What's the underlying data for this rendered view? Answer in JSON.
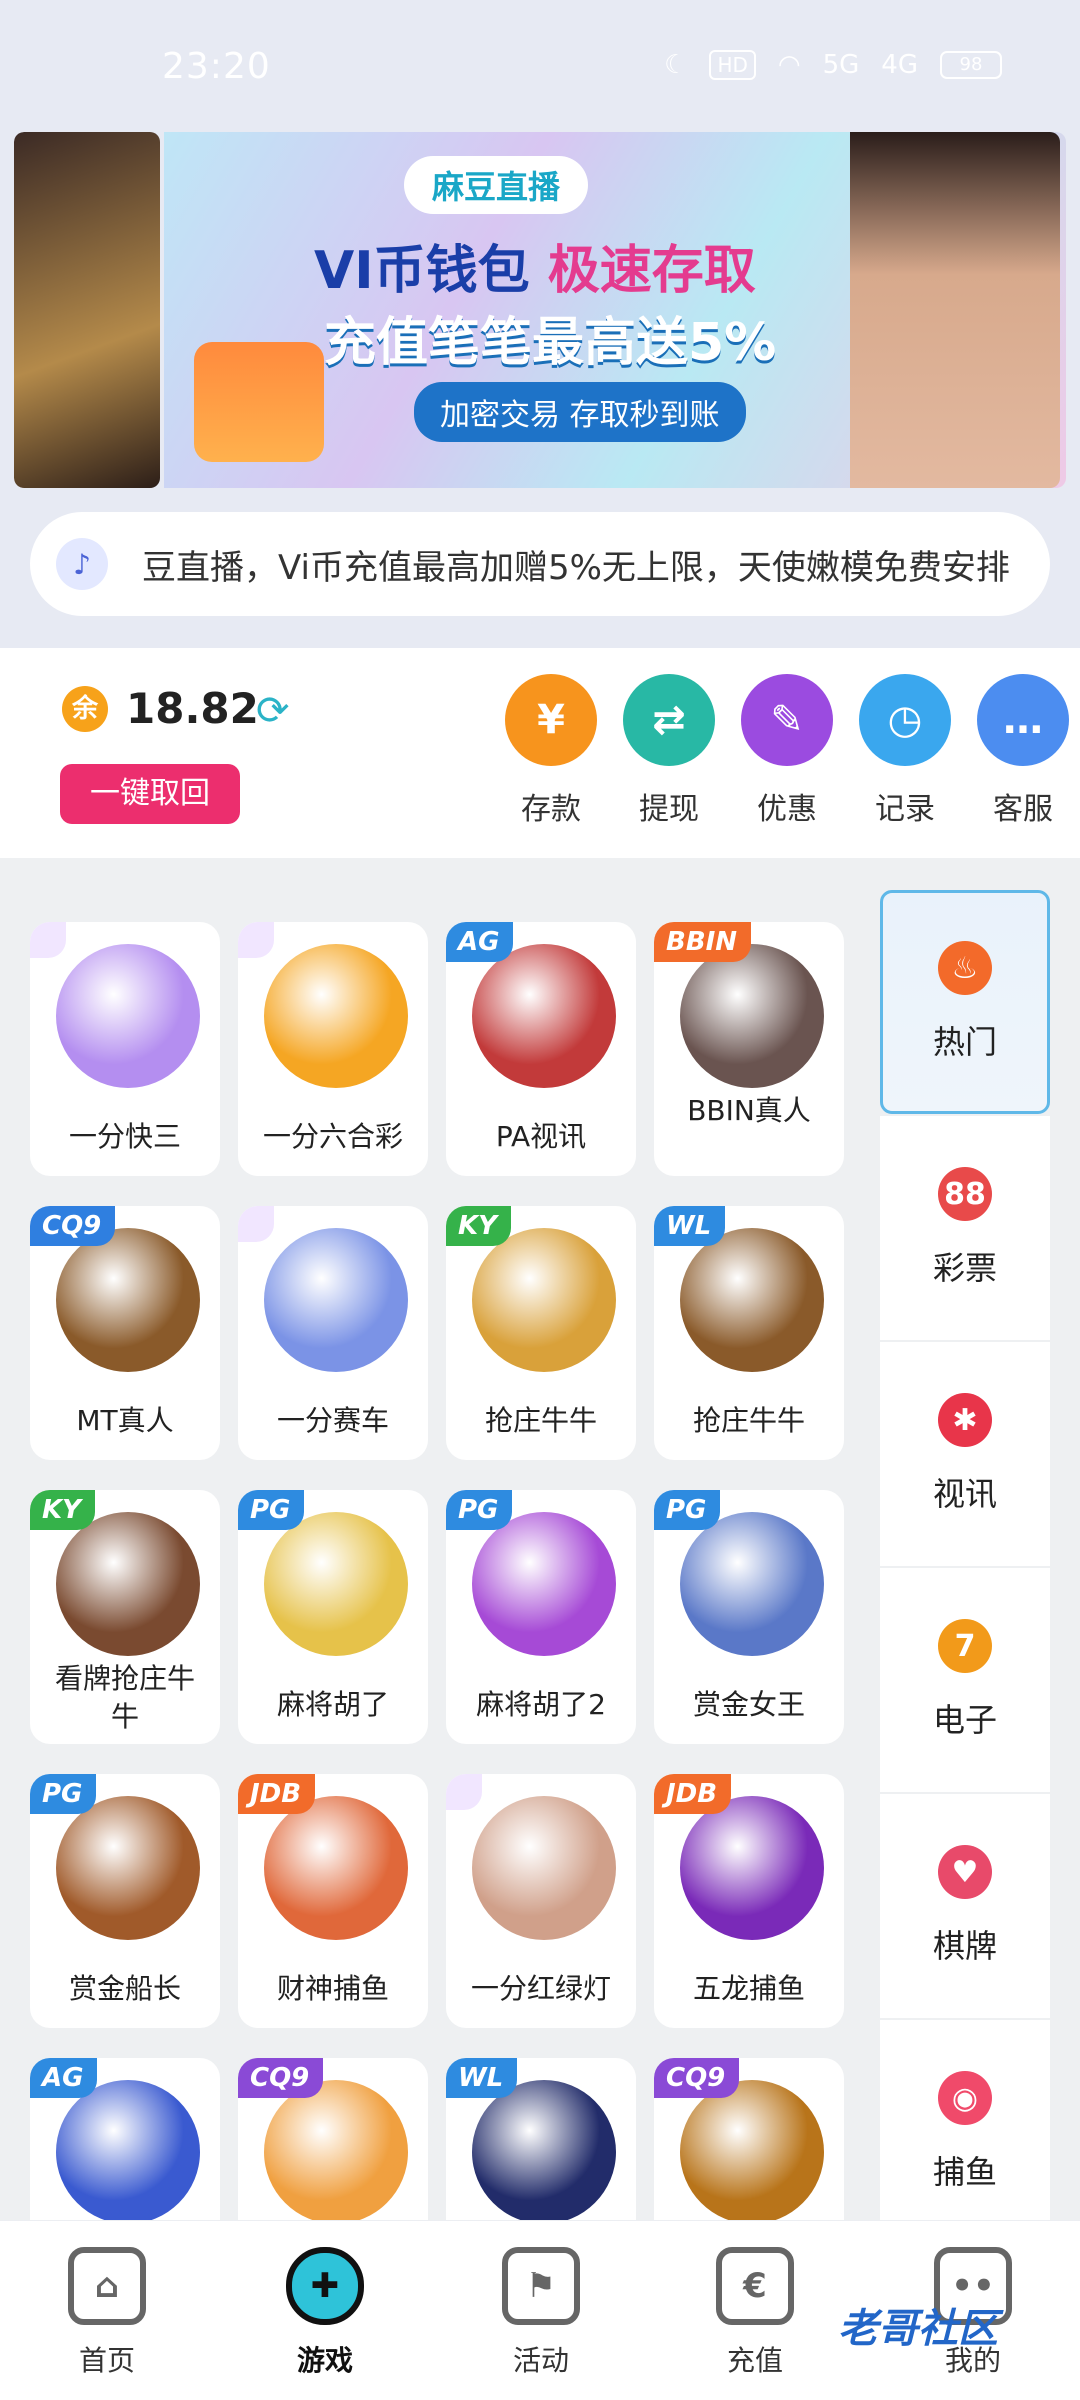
{
  "status_bar": {
    "time": "23:20",
    "hd": "HD",
    "net1": "5G",
    "net2": "4G",
    "battery": "98"
  },
  "banner": {
    "brand": "麻豆直播",
    "line1a": "VI币钱包",
    "line1b": "极速存取",
    "line2": "充值笔笔最高送5%",
    "line3": "加密交易 存取秒到账"
  },
  "marquee": {
    "text": "豆直播，Vi币充值最高加赠5%无上限，天使嫩模免费安排"
  },
  "wallet": {
    "balance_icon": "余",
    "balance": "18.82",
    "withdraw_all": "一键取回",
    "actions": [
      {
        "label": "存款",
        "icon": "yen-icon",
        "color": "#f7941d",
        "glyph": "¥"
      },
      {
        "label": "提现",
        "icon": "exchange-icon",
        "color": "#28b8a5",
        "glyph": "⇄"
      },
      {
        "label": "优惠",
        "icon": "tag-icon",
        "color": "#9b4be0",
        "glyph": "✎"
      },
      {
        "label": "记录",
        "icon": "clock-icon",
        "color": "#3aa7ee",
        "glyph": "◷"
      },
      {
        "label": "客服",
        "icon": "chat-icon",
        "color": "#4c8df0",
        "glyph": "…"
      }
    ]
  },
  "games": [
    {
      "name": "一分快三",
      "tag": "",
      "tag_color": "",
      "art": "#b48ef0"
    },
    {
      "name": "一分六合彩",
      "tag": "",
      "tag_color": "",
      "art": "#f5a623"
    },
    {
      "name": "PA视讯",
      "tag": "AG",
      "tag_color": "#2e8be0",
      "art": "#c23a3a"
    },
    {
      "name": "BBIN真人",
      "tag": "BBIN",
      "tag_color": "#f26b2a",
      "art": "#6a5450"
    },
    {
      "name": "MT真人",
      "tag": "CQ9",
      "tag_color": "#2f7fe0",
      "art": "#8a5a2a"
    },
    {
      "name": "一分赛车",
      "tag": "",
      "tag_color": "",
      "art": "#7b93e6"
    },
    {
      "name": "抢庄牛牛",
      "tag": "KY",
      "tag_color": "#35b24a",
      "art": "#d9a13a"
    },
    {
      "name": "抢庄牛牛",
      "tag": "WL",
      "tag_color": "#2e8be0",
      "art": "#8a5a2a"
    },
    {
      "name": "看牌抢庄牛牛",
      "tag": "KY",
      "tag_color": "#35b24a",
      "art": "#7a4a30"
    },
    {
      "name": "麻将胡了",
      "tag": "PG",
      "tag_color": "#2e8be0",
      "art": "#e6c24a"
    },
    {
      "name": "麻将胡了2",
      "tag": "PG",
      "tag_color": "#2e8be0",
      "art": "#a64ad6"
    },
    {
      "name": "赏金女王",
      "tag": "PG",
      "tag_color": "#2e8be0",
      "art": "#5a78c8"
    },
    {
      "name": "赏金船长",
      "tag": "PG",
      "tag_color": "#2e8be0",
      "art": "#a05a2a"
    },
    {
      "name": "财神捕鱼",
      "tag": "JDB",
      "tag_color": "#f26b2a",
      "art": "#e0683a"
    },
    {
      "name": "一分红绿灯",
      "tag": "",
      "tag_color": "",
      "art": "#d0a08a"
    },
    {
      "name": "五龙捕鱼",
      "tag": "JDB",
      "tag_color": "#f26b2a",
      "art": "#7a2ab8"
    },
    {
      "name": "",
      "tag": "AG",
      "tag_color": "#2e8be0",
      "art": "#3a5ad0"
    },
    {
      "name": "",
      "tag": "CQ9",
      "tag_color": "#8a4ad6",
      "art": "#f0a040"
    },
    {
      "name": "",
      "tag": "WL",
      "tag_color": "#2e8be0",
      "art": "#222c6a"
    },
    {
      "name": "",
      "tag": "CQ9",
      "tag_color": "#8a4ad6",
      "art": "#b8741a"
    }
  ],
  "categories": [
    {
      "label": "热门",
      "icon": "fire-icon",
      "color": "#f36a2a",
      "glyph": "♨",
      "active": true
    },
    {
      "label": "彩票",
      "icon": "lottery-ball-icon",
      "color": "#e84a4a",
      "glyph": "88",
      "active": false
    },
    {
      "label": "视讯",
      "icon": "chip-icon",
      "color": "#e8354a",
      "glyph": "✱",
      "active": false
    },
    {
      "label": "电子",
      "icon": "slot-seven-icon",
      "color": "#f29a1a",
      "glyph": "7",
      "active": false
    },
    {
      "label": "棋牌",
      "icon": "cards-icon",
      "color": "#e84a6a",
      "glyph": "♥",
      "active": false
    },
    {
      "label": "捕鱼",
      "icon": "fish-icon",
      "color": "#f04a6a",
      "glyph": "◉",
      "active": false
    }
  ],
  "tabbar": [
    {
      "label": "首页",
      "icon": "home-icon",
      "glyph": "⌂",
      "active": false
    },
    {
      "label": "游戏",
      "icon": "gamepad-icon",
      "glyph": "✚",
      "active": true
    },
    {
      "label": "活动",
      "icon": "flag-icon",
      "glyph": "⚑",
      "active": false
    },
    {
      "label": "充值",
      "icon": "wallet-icon",
      "glyph": "€",
      "active": false
    },
    {
      "label": "我的",
      "icon": "face-icon",
      "glyph": "••",
      "active": false
    }
  ],
  "watermark": "老哥社区"
}
